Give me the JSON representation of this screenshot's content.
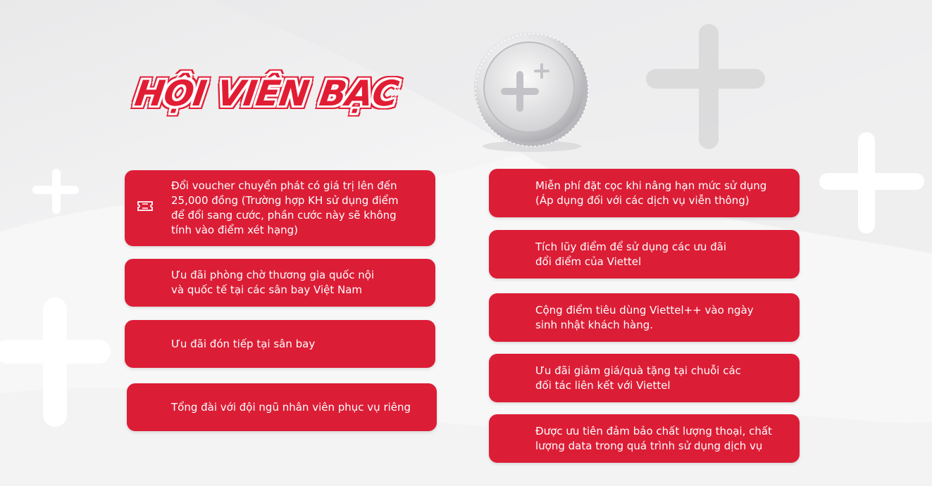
{
  "title": "HỘI VIÊN BẠC",
  "left_benefits": [
    "Đổi voucher chuyển phát có giá trị lên đến\n25,000 đồng (Trường hợp KH sử dụng điểm\nđể đổi sang cước, phần cước này sẽ không\ntính vào điểm xét hạng)",
    "Ưu đãi phòng chờ thương gia quốc nội\nvà quốc tế tại các sân bay Việt Nam",
    "Ưu đãi đón tiếp tại sân bay",
    "Tổng đài với đội ngũ nhân viên phục vụ riêng"
  ],
  "right_benefits": [
    "Miễn phí đặt cọc khi nâng hạn mức sử dụng\n(Áp dụng đối với các dịch vụ viễn thông)",
    "Tích lũy điểm để sử dụng các ưu đãi\nđổi điểm của Viettel",
    "Cộng điểm tiêu dùng Viettel++ vào ngày\nsinh nhật khách hàng.",
    "Ưu đãi giảm giá/quà tặng tại chuỗi các\nđối tác liên kết với Viettel",
    "Được ưu tiên đảm bảo chất lượng thoại, chất\nlượng data trong quá trình sử dụng dịch vụ"
  ],
  "icons": {
    "voucher": "ticket-icon",
    "coin": "silver-coin-plus-icon"
  },
  "colors": {
    "brand_red": "#dc1d36",
    "background": "#f2f2f3"
  }
}
